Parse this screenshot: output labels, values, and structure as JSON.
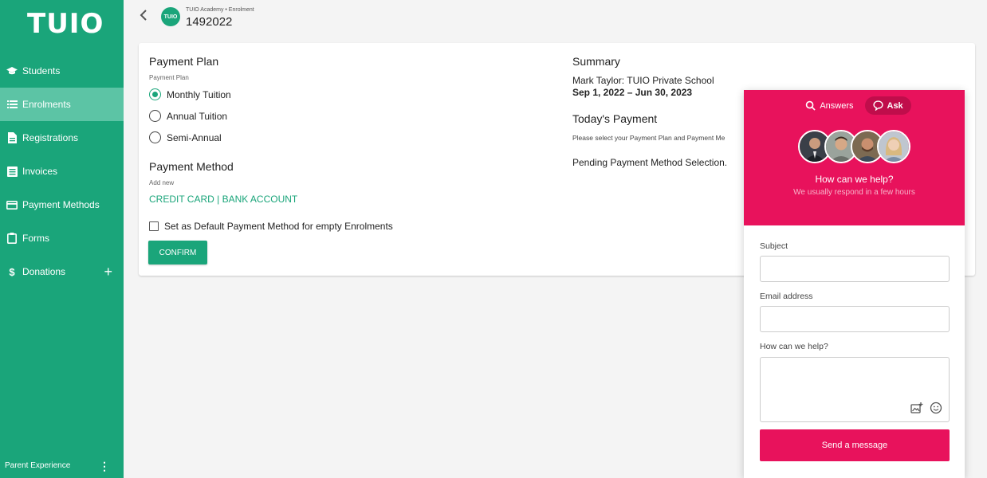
{
  "brand": {
    "logo_text": "TUIO"
  },
  "sidebar": {
    "items": [
      {
        "label": "Students",
        "icon": "graduation-cap-icon"
      },
      {
        "label": "Enrolments",
        "icon": "list-icon"
      },
      {
        "label": "Registrations",
        "icon": "document-icon"
      },
      {
        "label": "Invoices",
        "icon": "invoice-icon"
      },
      {
        "label": "Payment Methods",
        "icon": "credit-card-icon"
      },
      {
        "label": "Forms",
        "icon": "clipboard-icon"
      },
      {
        "label": "Donations",
        "icon": "dollar-icon"
      }
    ],
    "active": "Enrolments",
    "footer_label": "Parent Experience"
  },
  "header": {
    "avatar_text": "TUIO",
    "breadcrumb": "TUIO Academy • Enrolment",
    "title": "1492022"
  },
  "payment_plan": {
    "title": "Payment Plan",
    "sub_label": "Payment Plan",
    "options": [
      "Monthly Tuition",
      "Annual Tuition",
      "Semi-Annual"
    ],
    "selected": "Monthly Tuition"
  },
  "payment_method": {
    "title": "Payment Method",
    "sub_label": "Add new",
    "links": "CREDIT CARD | BANK ACCOUNT",
    "default_checkbox_label": "Set as Default Payment Method for empty Enrolments",
    "confirm_label": "CONFIRM"
  },
  "summary": {
    "title": "Summary",
    "student_line": "Mark Taylor: TUIO Private School",
    "date_range": "Sep 1, 2022 – Jun 30, 2023",
    "today_title": "Today's Payment",
    "today_note": "Please select your Payment Plan and Payment Me",
    "pending": "Pending Payment Method Selection."
  },
  "help_widget": {
    "tab_answers": "Answers",
    "tab_ask": "Ask",
    "title": "How can we help?",
    "subtitle": "We usually respond in a few hours",
    "subject_label": "Subject",
    "email_label": "Email address",
    "message_label": "How can we help?",
    "send_label": "Send a message"
  },
  "colors": {
    "brand_green": "#1aa57a",
    "sidebar_active": "#5cc4a5",
    "widget_pink": "#e8125c"
  }
}
